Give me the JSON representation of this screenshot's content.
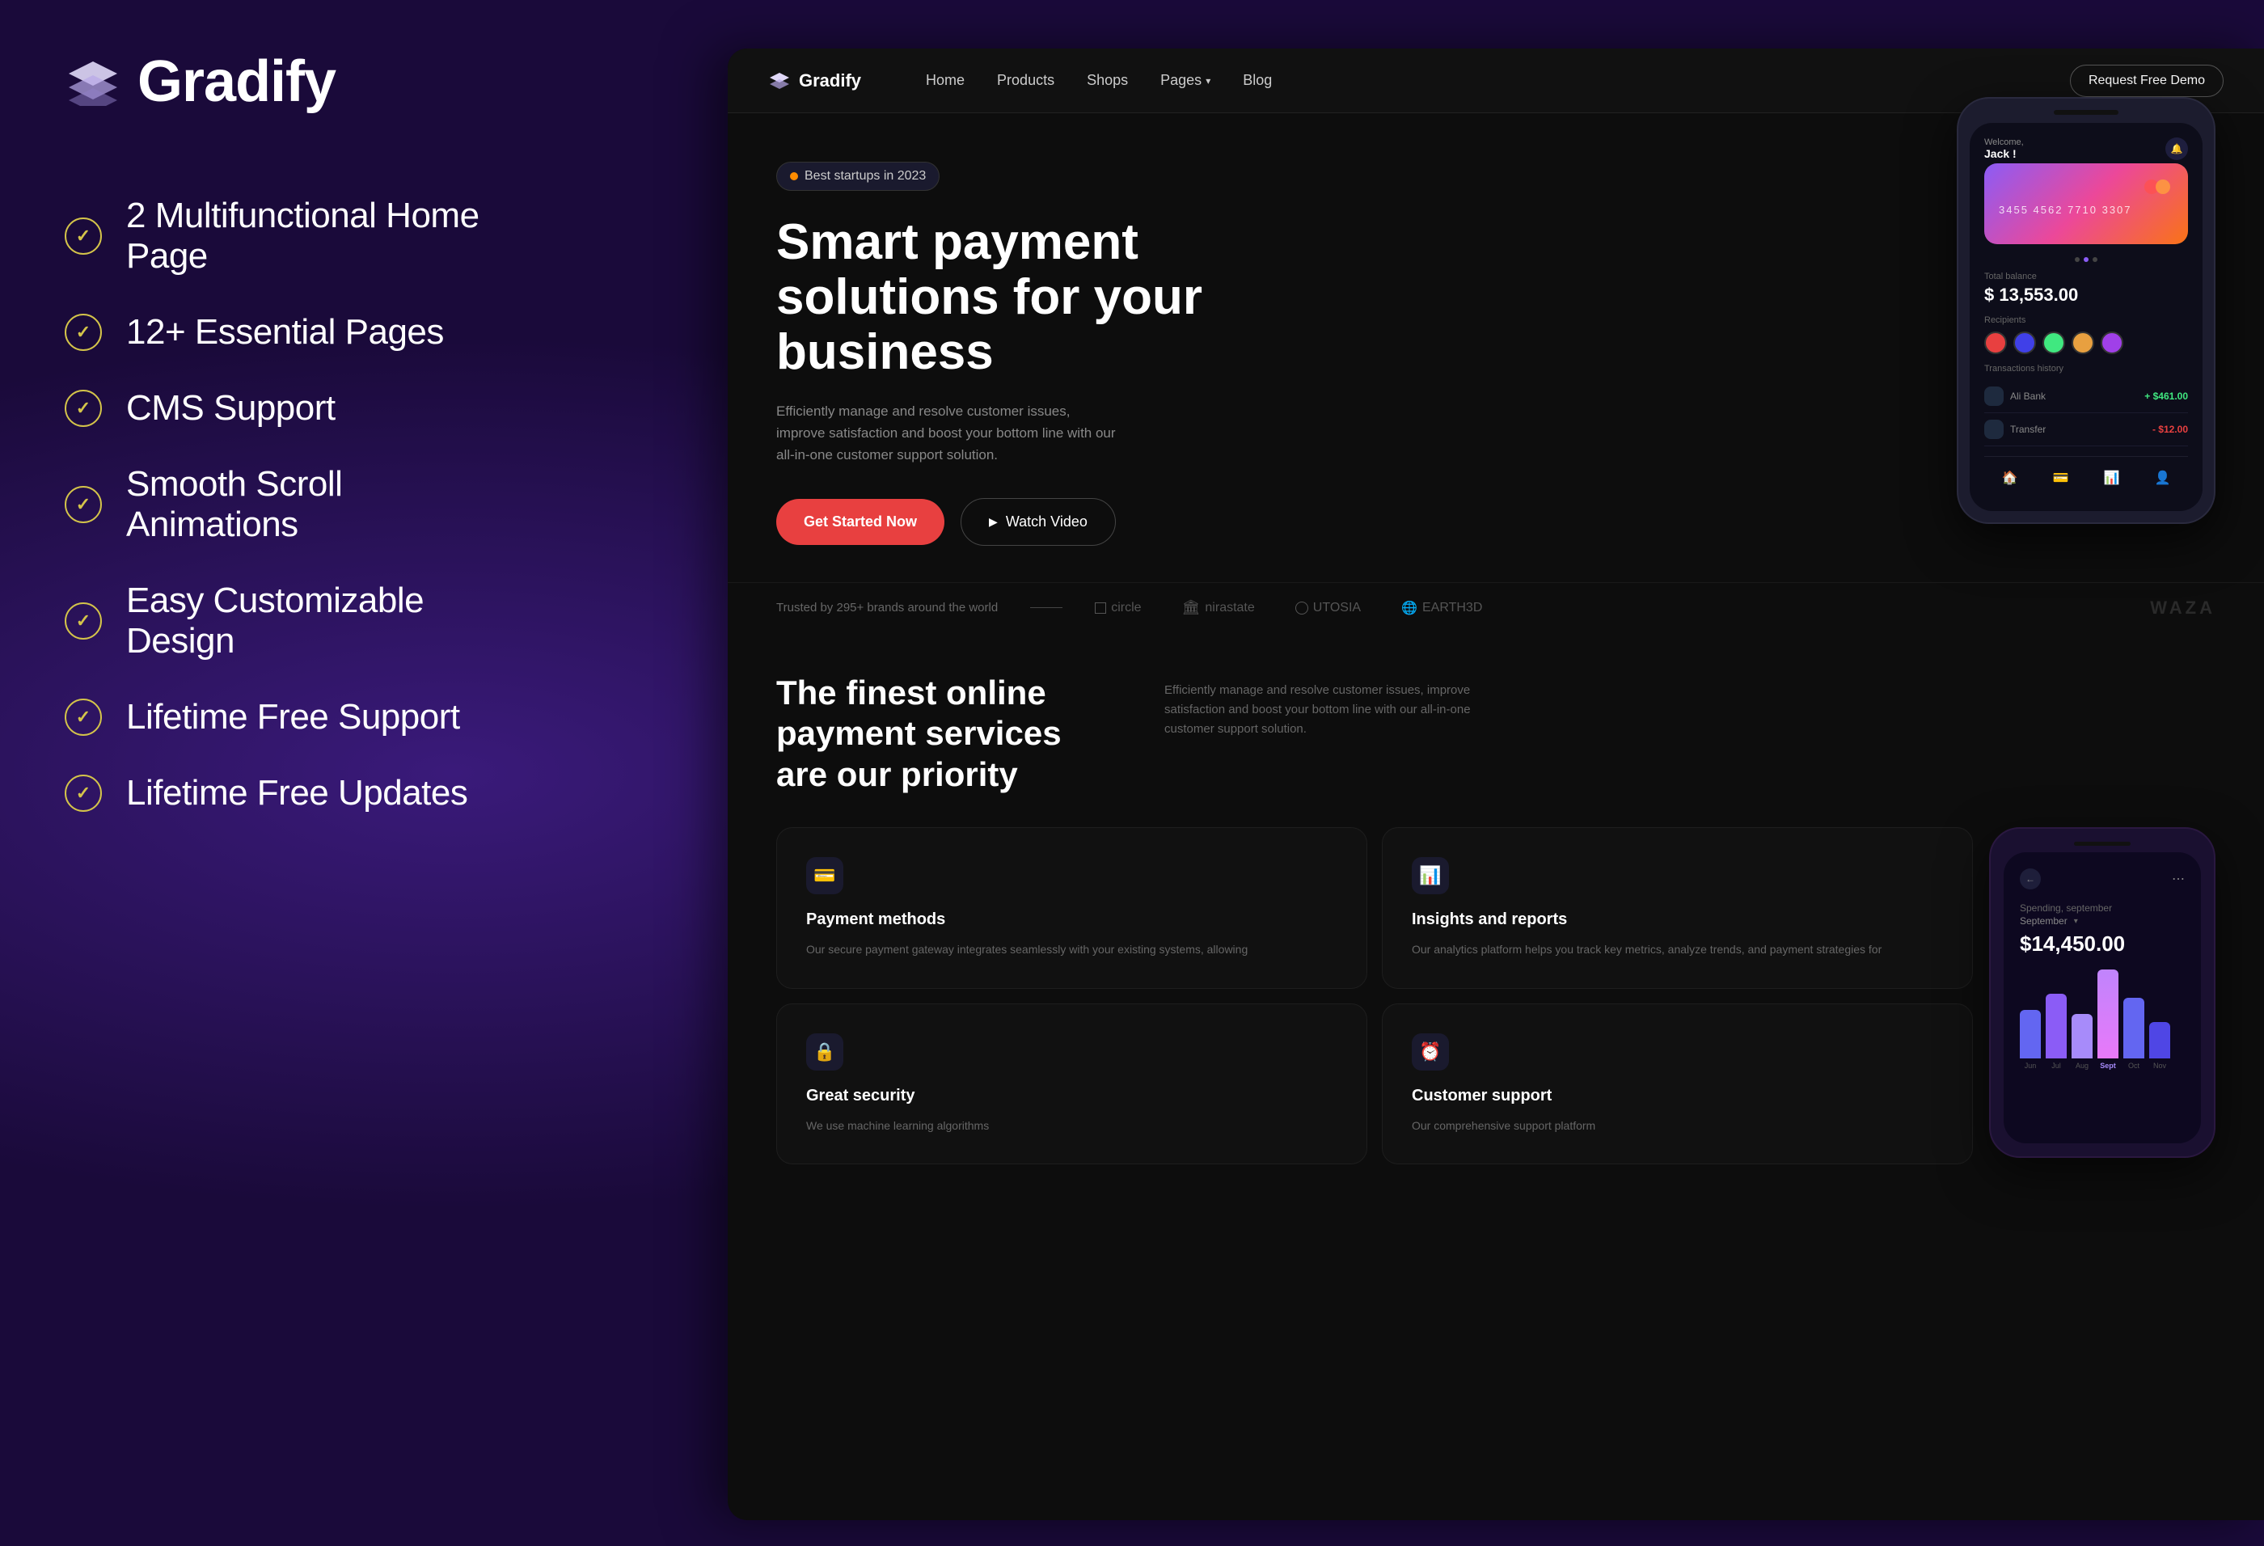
{
  "background": {
    "color": "#0d0820"
  },
  "left_panel": {
    "logo": {
      "text": "Gradify"
    },
    "features": [
      {
        "id": "f1",
        "text": "2 Multifunctional Home Page"
      },
      {
        "id": "f2",
        "text": "12+ Essential Pages"
      },
      {
        "id": "f3",
        "text": "CMS Support"
      },
      {
        "id": "f4",
        "text": "Smooth Scroll Animations"
      },
      {
        "id": "f5",
        "text": "Easy Customizable Design"
      },
      {
        "id": "f6",
        "text": "Lifetime Free Support"
      },
      {
        "id": "f7",
        "text": "Lifetime Free Updates"
      }
    ]
  },
  "browser": {
    "navbar": {
      "logo": "Gradify",
      "nav_links": [
        {
          "label": "Home",
          "has_dropdown": false
        },
        {
          "label": "Products",
          "has_dropdown": false
        },
        {
          "label": "Shops",
          "has_dropdown": false
        },
        {
          "label": "Pages",
          "has_dropdown": true
        },
        {
          "label": "Blog",
          "has_dropdown": false
        }
      ],
      "cta_button": "Request Free Demo"
    },
    "hero": {
      "badge": "Best startups in 2023",
      "title": "Smart payment solutions for your business",
      "description": "Efficiently manage and resolve customer issues, improve satisfaction and boost your bottom line with our all-in-one customer support solution.",
      "btn_primary": "Get Started Now",
      "btn_secondary": "Watch Video"
    },
    "phone_card": {
      "greeting": "Welcome, Jack !",
      "card_number": "3455 4562 7710 3307",
      "total_balance_label": "Total balance",
      "total_balance": "$ 13,553.00",
      "recipients_label": "Recipients",
      "transactions_label": "Transactions history",
      "transactions": [
        {
          "name": "Ali Bank",
          "amount": "+ $461.00",
          "positive": true
        },
        {
          "name": "Transfer",
          "amount": "- $12.00",
          "positive": false
        }
      ]
    },
    "brands": {
      "trusted_text": "Trusted by 295+ brands around the world",
      "brands_list": [
        {
          "name": "circle",
          "has_icon": true
        },
        {
          "name": "nirastate",
          "has_icon": true
        },
        {
          "name": "UTOSIA",
          "has_icon": true
        },
        {
          "name": "EARTH3D",
          "has_icon": true
        }
      ],
      "extra": "WAZA"
    },
    "features_section": {
      "title": "The finest online payment services are our priority",
      "description": "Efficiently manage and resolve customer issues, improve satisfaction and boost your bottom line with our all-in-one customer support solution.",
      "cards": [
        {
          "id": "payment",
          "icon": "💳",
          "title": "Payment methods",
          "description": "Our secure payment gateway integrates seamlessly with your existing systems, allowing"
        },
        {
          "id": "insights",
          "icon": "📊",
          "title": "Insights and reports",
          "description": "Our analytics platform helps you track key metrics, analyze trends, and payment strategies for"
        },
        {
          "id": "security",
          "icon": "🔒",
          "title": "Great security",
          "description": "We use machine learning algorithms"
        },
        {
          "id": "support",
          "icon": "⏰",
          "title": "Customer support",
          "description": "Our comprehensive support platform"
        }
      ]
    },
    "analytics_phone": {
      "spending_label": "Spending, september",
      "month": "September",
      "amount": "$14,450.00",
      "bar_labels": [
        "Jun",
        "Jul",
        "Aug",
        "Sept",
        "Oct",
        "Nov"
      ],
      "bar_heights": [
        60,
        80,
        55,
        110,
        75,
        45
      ]
    }
  }
}
